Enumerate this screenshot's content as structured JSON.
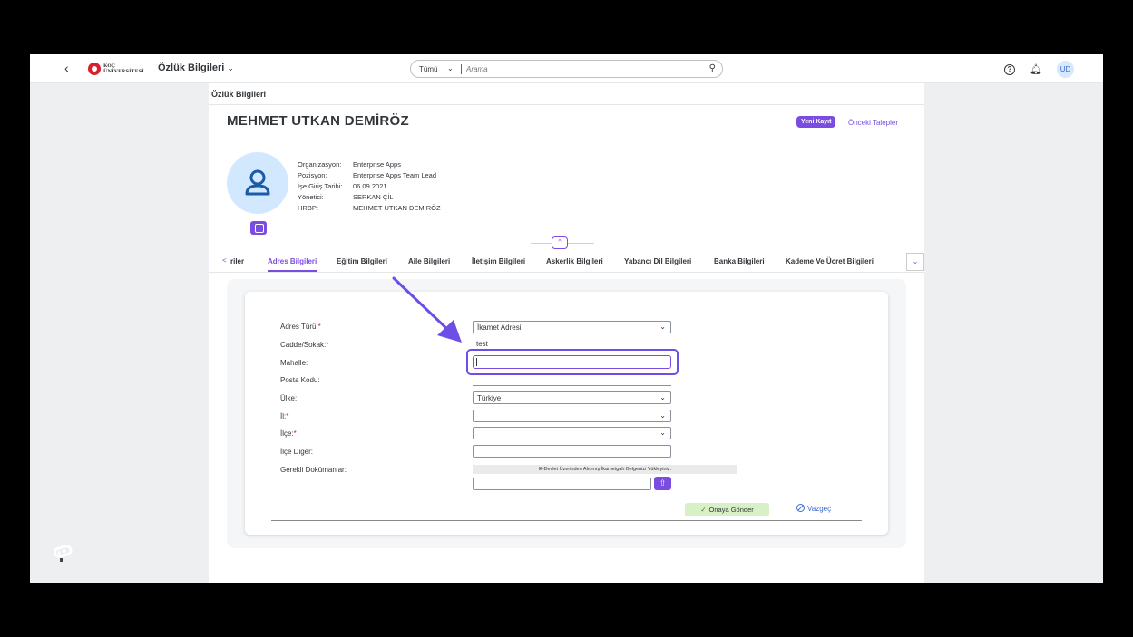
{
  "topbar": {
    "logo_text_line1": "KOÇ",
    "logo_text_line2": "ÜNİVERSİTESİ",
    "app_title": "Özlük Bilgileri",
    "search_scope": "Tümü",
    "search_placeholder": "Arama",
    "avatar_initials": "UD"
  },
  "page": {
    "section_title": "Özlük Bilgileri",
    "person_name": "MEHMET UTKAN DEMİRÖZ",
    "new_record_label": "Yeni Kayıt",
    "previous_requests_label": "Önceki Talepler",
    "info": [
      {
        "key": "Organizasyon:",
        "value": "Enterprise Apps"
      },
      {
        "key": "Pozisyon:",
        "value": "Enterprise Apps Team Lead"
      },
      {
        "key": "İşe Giriş Tarihi:",
        "value": "06.09.2021"
      },
      {
        "key": "Yönetici:",
        "value": "SERKAN ÇİL"
      },
      {
        "key": "HRBP:",
        "value": "MEHMET UTKAN DEMİRÖZ"
      }
    ]
  },
  "tabs": {
    "prev_partial": "riler",
    "items": [
      {
        "label": "Adres Bilgileri",
        "active": true
      },
      {
        "label": "Eğitim Bilgileri"
      },
      {
        "label": "Aile Bilgileri"
      },
      {
        "label": "İletişim Bilgileri"
      },
      {
        "label": "Askerlik Bilgileri"
      },
      {
        "label": "Yabancı Dil Bilgileri"
      },
      {
        "label": "Banka Bilgileri"
      },
      {
        "label": "Kademe Ve Ücret Bilgileri"
      }
    ]
  },
  "form": {
    "fields": [
      {
        "label": "Adres Türü:",
        "required": true,
        "value": "İkamet Adresi",
        "type": "select"
      },
      {
        "label": "Cadde/Sokak:",
        "required": true,
        "value": "test",
        "type": "text"
      },
      {
        "label": "Mahalle:",
        "required": false,
        "value": "",
        "type": "text",
        "focused": true
      },
      {
        "label": "Posta Kodu:",
        "required": false,
        "value": "",
        "type": "text"
      },
      {
        "label": "Ülke:",
        "required": false,
        "value": "Türkiye",
        "type": "select"
      },
      {
        "label": "İl:",
        "required": true,
        "value": "",
        "type": "select"
      },
      {
        "label": "İlçe:",
        "required": true,
        "value": "",
        "type": "select"
      },
      {
        "label": "İlçe Diğer:",
        "required": false,
        "value": "",
        "type": "text"
      },
      {
        "label": "Gerekli Dokümanlar:",
        "required": false,
        "value": "",
        "type": "upload"
      }
    ],
    "required_mark": "*",
    "document_note": "E-Devlet Üzerinden Alınmış İkametgah Belgenizi Yükleyiniz.",
    "send_label": "Onaya Gönder",
    "cancel_label": "Vazgeç"
  },
  "colors": {
    "accent": "#7a4de0",
    "highlight": "#6d4fe8",
    "send_bg": "#d8f0c6"
  }
}
